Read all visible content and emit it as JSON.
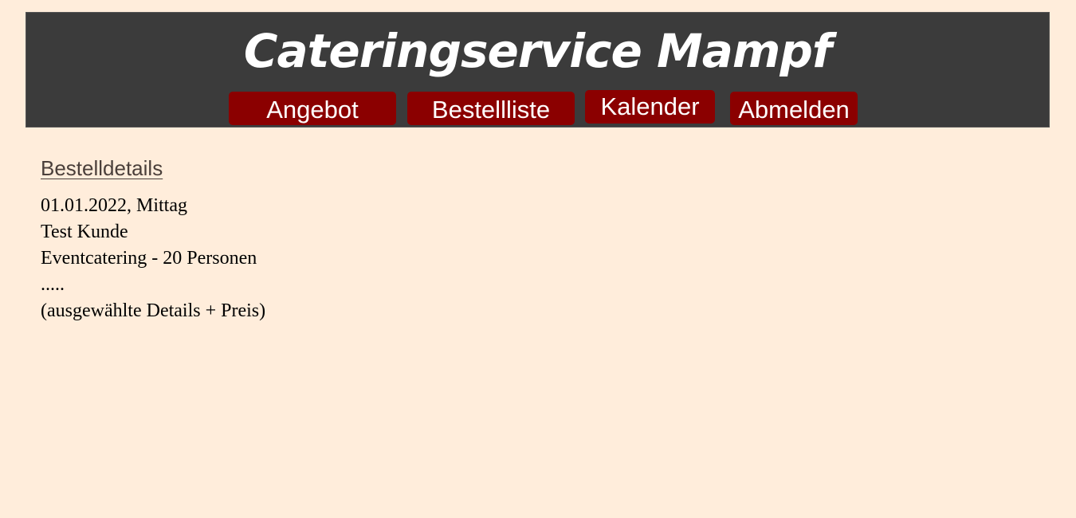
{
  "header": {
    "title": "Cateringservice Mampf",
    "nav": [
      {
        "label": "Angebot"
      },
      {
        "label": "Bestellliste"
      },
      {
        "label": "Kalender"
      },
      {
        "label": "Abmelden"
      }
    ]
  },
  "main": {
    "heading": "Bestelldetails",
    "order": {
      "date_line": "01.01.2022, Mittag",
      "customer": "Test Kunde",
      "service": "Eventcatering - 20 Personen",
      "ellipsis": ".....",
      "details_note": "(ausgewählte Details + Preis)"
    }
  },
  "colors": {
    "background": "#ffeddb",
    "header_background": "#3b3b3b",
    "nav_button": "#8b0000",
    "header_text": "#ffffff"
  }
}
